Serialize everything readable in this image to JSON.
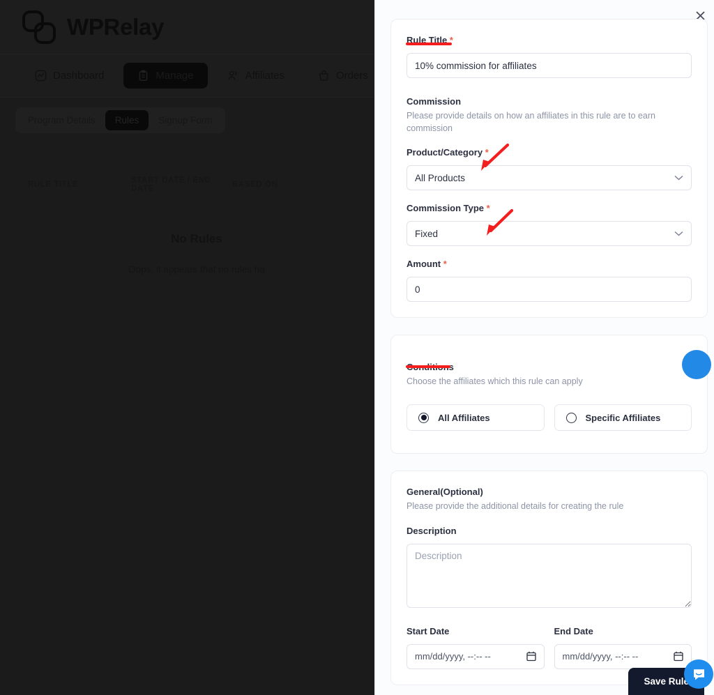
{
  "app": {
    "brand": "WPRelay",
    "brand_logo_icon": "interlocking-squares-logo",
    "nav": [
      {
        "label": "Dashboard",
        "icon": "chart-activity-icon",
        "active": false
      },
      {
        "label": "Manage",
        "icon": "clipboard-icon",
        "active": true
      },
      {
        "label": "Affiliates",
        "icon": "users-icon",
        "active": false
      },
      {
        "label": "Orders",
        "icon": "bag-icon",
        "active": false
      }
    ],
    "subtabs": [
      {
        "label": "Program Details",
        "active": false
      },
      {
        "label": "Rules",
        "active": true
      },
      {
        "label": "Signup Form",
        "active": false
      }
    ],
    "table": {
      "columns": [
        "RULE TITLE",
        "START DATE / END DATE",
        "BASED ON"
      ]
    },
    "empty_state": {
      "title": "No Rules",
      "message": "Oops, it appears that no rules ha"
    }
  },
  "modal": {
    "close_icon": "close-x-icon",
    "rule_title": {
      "label": "Rule Title",
      "required_marker": "*",
      "value": "10% commission for affiliates",
      "placeholder": "Rule Title"
    },
    "commission": {
      "heading": "Commission",
      "description": "Please provide details on how an affiliates in this rule are to earn commission",
      "product_category": {
        "label": "Product/Category",
        "required_marker": "*",
        "value": "All Products",
        "chevron_icon": "chevron-down-icon"
      },
      "commission_type": {
        "label": "Commission Type",
        "required_marker": "*",
        "value": "Fixed",
        "chevron_icon": "chevron-down-icon"
      },
      "amount": {
        "label": "Amount",
        "required_marker": "*",
        "value": "0",
        "placeholder": "0"
      }
    },
    "conditions": {
      "heading": "Conditions",
      "description": "Choose the affiliates which this rule can apply",
      "options": [
        {
          "label": "All Affiliates",
          "selected": true
        },
        {
          "label": "Specific Affiliates",
          "selected": false
        }
      ]
    },
    "general": {
      "heading": "General(Optional)",
      "description": "Please provide the additional details for creating the rule",
      "description_field": {
        "label": "Description",
        "value": "",
        "placeholder": "Description"
      },
      "start_date": {
        "label": "Start Date",
        "value": "mm/dd/yyyy, --:-- --",
        "calendar_icon": "calendar-icon"
      },
      "end_date": {
        "label": "End Date",
        "value": "mm/dd/yyyy, --:-- --",
        "calendar_icon": "calendar-icon"
      }
    },
    "save_label": "Save Rule"
  },
  "widgets": {
    "intercom_icon": "intercom-chat-icon",
    "cursor_indicator": "blue-click-indicator"
  },
  "colors": {
    "annotation_red": "#f41e1e",
    "accent_blue": "#1f8ded",
    "required_red": "#e8604c",
    "dark_button": "#131a2d"
  }
}
